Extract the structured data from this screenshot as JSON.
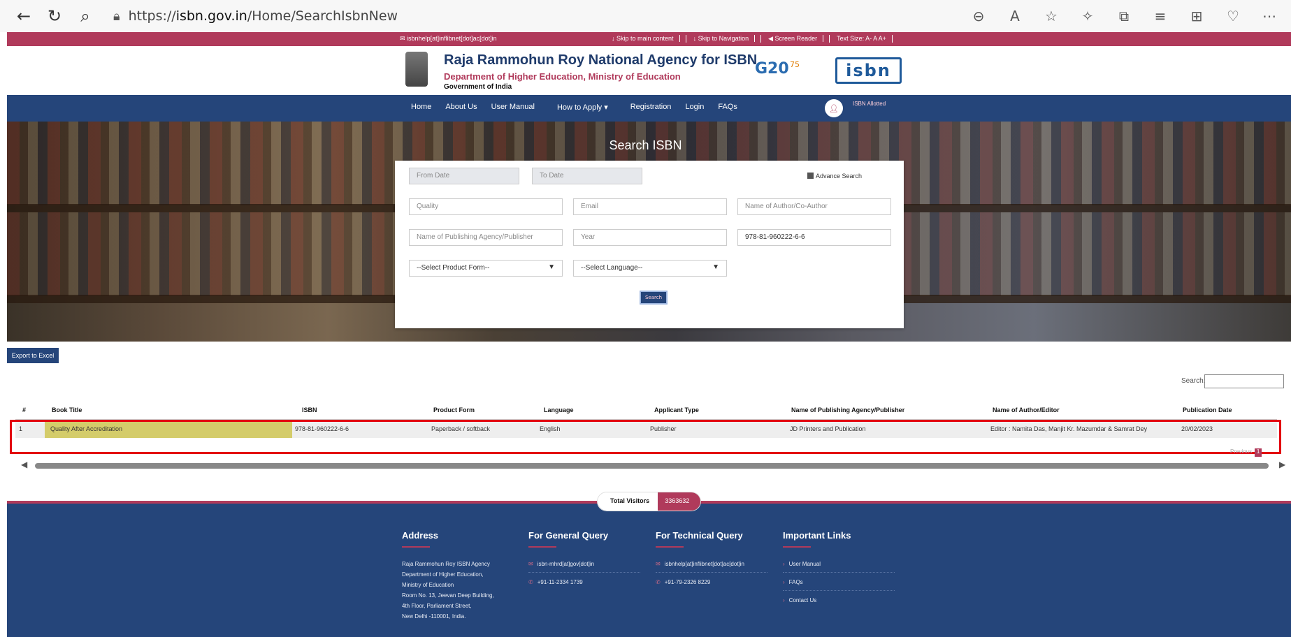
{
  "browser": {
    "url_prefix": "https://",
    "url_host": "isbn.gov.in",
    "url_path": "/Home/SearchIsbnNew"
  },
  "topbar": {
    "email": "isbnhelp[at]inflibnet[dot]ac[dot]in",
    "skip_main": "Skip to main content",
    "skip_nav": "Skip to Navigation",
    "screen_reader": "Screen Reader",
    "text_size": "Text Size: A- A A+"
  },
  "header": {
    "title": "Raja Rammohun Roy National Agency for ISBN",
    "department": "Department of Higher Education, Ministry of Education",
    "government": "Government of India",
    "g20": "G20",
    "isbn_logo": "isbn"
  },
  "nav": {
    "items": [
      "Home",
      "About Us",
      "User Manual",
      "How to Apply ▾",
      "Registration",
      "Login",
      "FAQs"
    ],
    "avatar_label": "ISBN Allotted"
  },
  "search": {
    "title": "Search ISBN",
    "from_date_placeholder": "From Date",
    "to_date_placeholder": "To Date",
    "advance_search_label": "Advance Search",
    "book_title_value": "Quality",
    "email_placeholder": "Email",
    "author_placeholder": "Name of Author/Co-Author",
    "publisher_placeholder": "Name of Publishing Agency/Publisher",
    "year_placeholder": "Year",
    "isbn_value": "978-81-960222-6-6",
    "product_form_selected": "--Select Product Form--",
    "language_selected": "--Select Language--",
    "search_button": "Search"
  },
  "results": {
    "export_label": "Export to Excel",
    "search_label": "Search:",
    "columns": [
      "#",
      "Book Title",
      "ISBN",
      "Product Form",
      "Language",
      "Applicant Type",
      "Name of Publishing Agency/Publisher",
      "Name of Author/Editor",
      "Publication Date"
    ],
    "rows": [
      [
        "1",
        "Quality After Accreditation",
        "978-81-960222-6-6",
        "Paperback / softback",
        "English",
        "Publisher",
        "JD Printers and Publication",
        "Editor : Namita Das, Manjit Kr. Mazumdar & Samrat Dey",
        "20/02/2023"
      ]
    ],
    "pagination_previous": "Previous",
    "pagination_current": "1"
  },
  "visitors": {
    "label": "Total Visitors",
    "count": "3363632"
  },
  "footer": {
    "address_title": "Address",
    "address_lines": [
      "Raja Rammohun Roy ISBN Agency",
      "Department of Higher Education,",
      "Ministry of Education",
      "Room No. 13, Jeevan Deep Building,",
      "4th Floor, Parliament Street,",
      "New Delhi -110001, India."
    ],
    "general_title": "For General Query",
    "general_email": "isbn-mhrd[at]gov[dot]in",
    "general_phone": "+91-11-2334 1739",
    "technical_title": "For Technical Query",
    "technical_email": "isbnhelp[at]inflibnet[dot]ac[dot]in",
    "technical_phone": "+91-79-2326 8229",
    "links_title": "Important Links",
    "links": [
      "User Manual",
      "FAQs",
      "Contact Us"
    ]
  },
  "colors": {
    "brand_navy": "#25457a",
    "brand_maroon": "#b03a5b",
    "highlight": "#d4cc6a",
    "annotation_red": "#e3000f"
  }
}
